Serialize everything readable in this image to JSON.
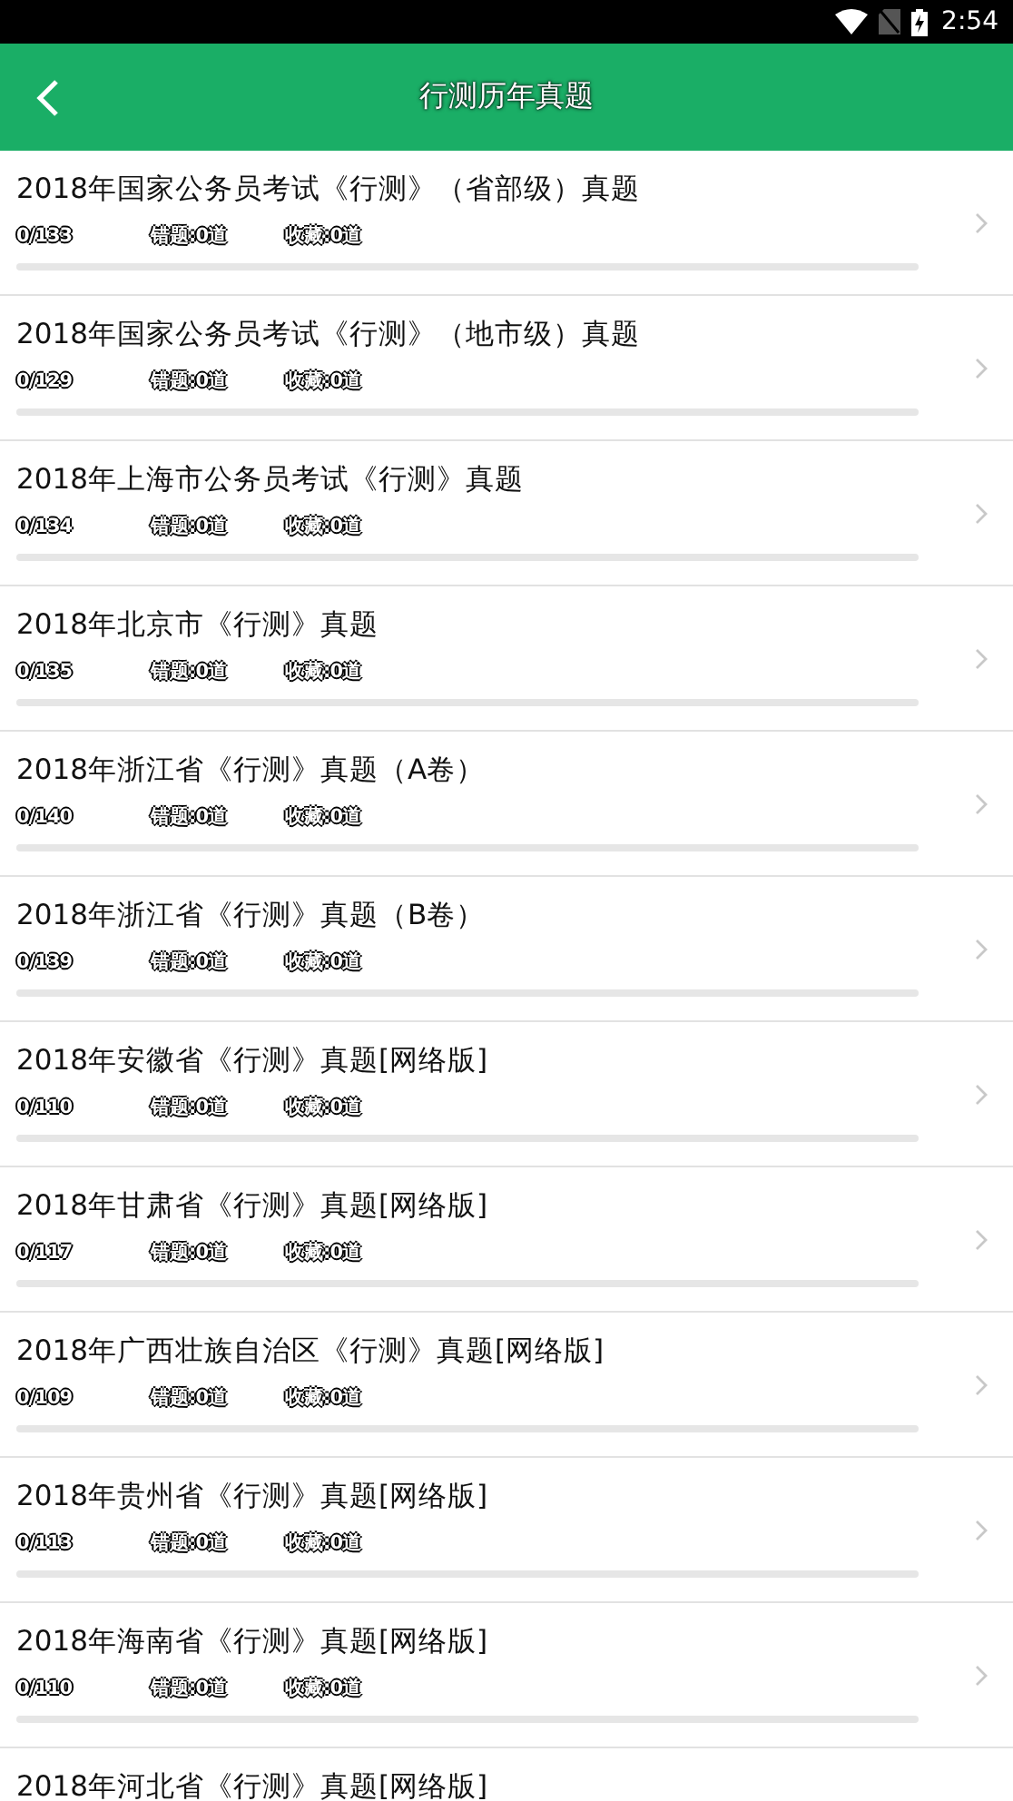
{
  "status_bar": {
    "time": "2:54"
  },
  "header": {
    "title": "行测历年真题"
  },
  "papers": [
    {
      "title": "2018年国家公务员考试《行测》（省部级）真题",
      "progress": "0/133",
      "wrong": "错题:0道",
      "saved": "收藏:0道",
      "level": 0
    },
    {
      "title": "2018年国家公务员考试《行测》（地市级）真题",
      "progress": "0/129",
      "wrong": "错题:0道",
      "saved": "收藏:0道",
      "level": 0
    },
    {
      "title": "2018年上海市公务员考试《行测》真题",
      "progress": "0/134",
      "wrong": "错题:0道",
      "saved": "收藏:0道",
      "level": 0
    },
    {
      "title": "2018年北京市《行测》真题",
      "progress": "0/135",
      "wrong": "错题:0道",
      "saved": "收藏:0道",
      "level": 0
    },
    {
      "title": "2018年浙江省《行测》真题（A卷）",
      "progress": "0/140",
      "wrong": "错题:0道",
      "saved": "收藏:0道",
      "level": 0
    },
    {
      "title": "2018年浙江省《行测》真题（B卷）",
      "progress": "0/139",
      "wrong": "错题:0道",
      "saved": "收藏:0道",
      "level": 0
    },
    {
      "title": "2018年安徽省《行测》真题[网络版]",
      "progress": "0/110",
      "wrong": "错题:0道",
      "saved": "收藏:0道",
      "level": 0
    },
    {
      "title": "2018年甘肃省《行测》真题[网络版]",
      "progress": "0/117",
      "wrong": "错题:0道",
      "saved": "收藏:0道",
      "level": 0
    },
    {
      "title": "2018年广西壮族自治区《行测》真题[网络版]",
      "progress": "0/109",
      "wrong": "错题:0道",
      "saved": "收藏:0道",
      "level": 0
    },
    {
      "title": "2018年贵州省《行测》真题[网络版]",
      "progress": "0/113",
      "wrong": "错题:0道",
      "saved": "收藏:0道",
      "level": 0
    },
    {
      "title": "2018年海南省《行测》真题[网络版]",
      "progress": "0/110",
      "wrong": "错题:0道",
      "saved": "收藏:0道",
      "level": 0
    },
    {
      "title": "2018年河北省《行测》真题[网络版]"
    }
  ]
}
